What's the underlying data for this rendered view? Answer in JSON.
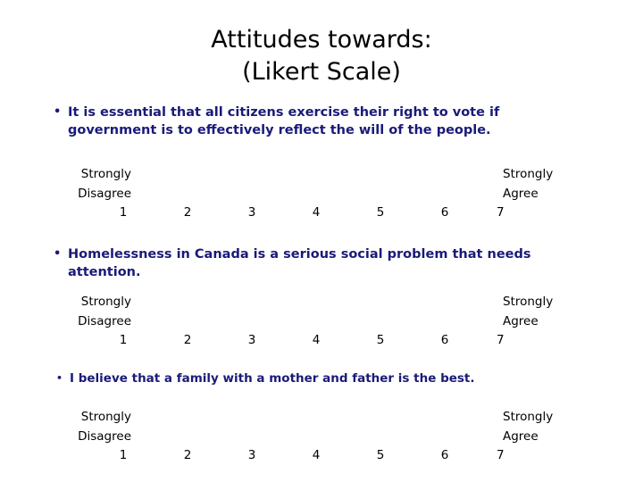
{
  "slide": {
    "background_color": "#ffffff",
    "title": {
      "line1": "Attitudes towards:",
      "line2": "(Likert Scale)",
      "color": "#000000"
    },
    "bullet_color": "#1a1a7a",
    "bullet_glyph": "•",
    "items": [
      {
        "statement": "It is essential that all citizens exercise their right to vote if government is to effectively reflect the will of the people.",
        "scale": {
          "left_anchor_line1": "Strongly",
          "left_anchor_line2": "Disagree",
          "right_anchor_line1": "Strongly",
          "right_anchor_line2": "Agree",
          "points": [
            "1",
            "2",
            "3",
            "4",
            "5",
            "6",
            "7"
          ]
        }
      },
      {
        "statement": "Homelessness in Canada is a serious social problem that needs attention.",
        "scale": {
          "left_anchor_line1": "Strongly",
          "left_anchor_line2": "Disagree",
          "right_anchor_line1": "Strongly",
          "right_anchor_line2": "Agree",
          "points": [
            "1",
            "2",
            "3",
            "4",
            "5",
            "6",
            "7"
          ]
        }
      },
      {
        "statement": "I believe that a family with a mother and father is the best.",
        "scale": {
          "left_anchor_line1": "Strongly",
          "left_anchor_line2": "Disagree",
          "right_anchor_line1": "Strongly",
          "right_anchor_line2": "Agree",
          "points": [
            "1",
            "2",
            "3",
            "4",
            "5",
            "6",
            "7"
          ]
        }
      }
    ]
  }
}
